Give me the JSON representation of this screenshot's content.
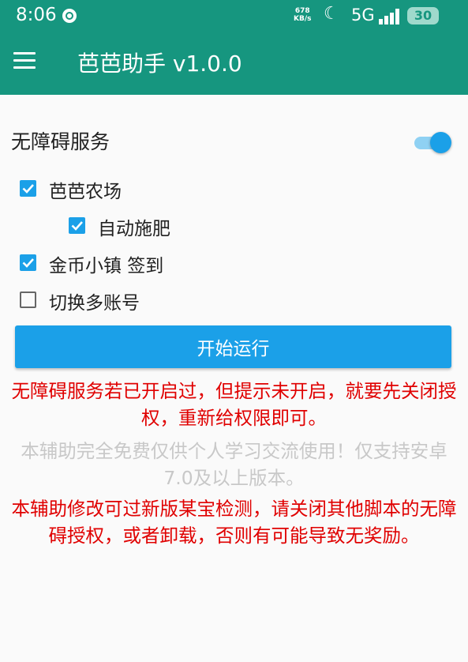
{
  "status_bar": {
    "time": "8:06",
    "speed_value": "678",
    "speed_unit": "KB/s",
    "network": "5G",
    "battery": "30",
    "icons": [
      "app-notification-icon",
      "moon-icon",
      "signal-icon",
      "battery-icon"
    ]
  },
  "app_bar": {
    "title": "芭芭助手 v1.0.0",
    "menu_icon": "hamburger-menu-icon"
  },
  "service": {
    "label": "无障碍服务",
    "enabled": true
  },
  "options": [
    {
      "label": "芭芭农场",
      "checked": true
    },
    {
      "label": "自动施肥",
      "checked": true
    },
    {
      "label": "金币小镇 签到",
      "checked": true
    },
    {
      "label": "切换多账号",
      "checked": false
    }
  ],
  "start_button": "开始运行",
  "notes": {
    "tip": "无障碍服务若已开启过，但提示未开启，就要先关闭授权，重新给权限即可。",
    "free": "本辅助完全免费仅供个人学习交流使用！仅支持安卓7.0及以上版本。",
    "warning": "本辅助修改可过新版某宝检测，请关闭其他脚本的无障碍授权，或者卸载，否则有可能导致无奖励。"
  },
  "colors": {
    "header": "#16967f",
    "accent": "#1ba0e8",
    "warning_text": "#e00000",
    "muted_text": "#c8c8c8"
  }
}
